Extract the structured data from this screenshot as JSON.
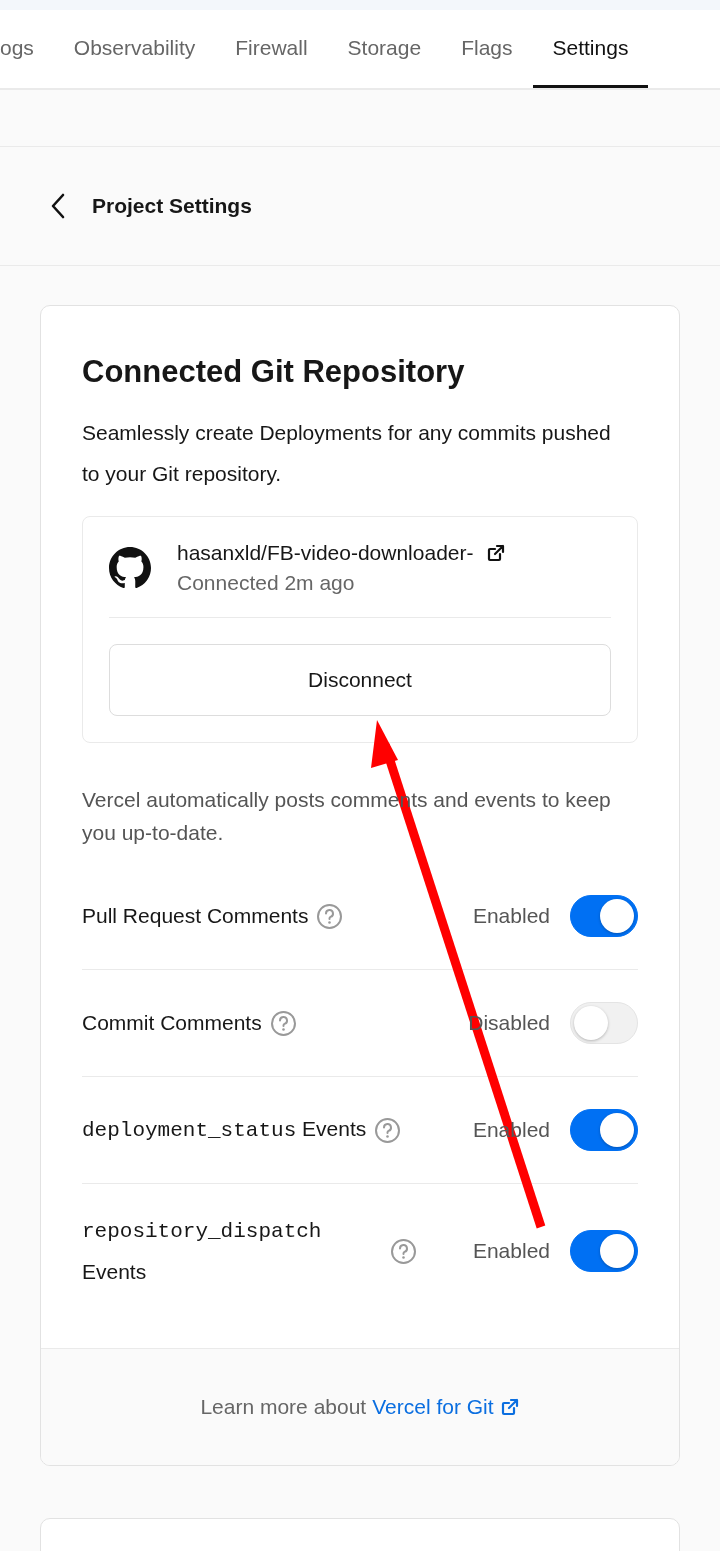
{
  "tabs": [
    {
      "label": "ogs",
      "selected": false
    },
    {
      "label": "Observability",
      "selected": false
    },
    {
      "label": "Firewall",
      "selected": false
    },
    {
      "label": "Storage",
      "selected": false
    },
    {
      "label": "Flags",
      "selected": false
    },
    {
      "label": "Settings",
      "selected": true
    }
  ],
  "header": {
    "title": "Project Settings"
  },
  "card": {
    "title": "Connected Git Repository",
    "description": "Seamlessly create Deployments for any commits pushed to your Git repository.",
    "repo": {
      "name": "hasanxld/FB-video-downloader-",
      "status": "Connected 2m ago",
      "button": "Disconnect"
    },
    "note": "Vercel automatically posts comments and events to keep you up-to-date.",
    "settings": [
      {
        "label": "Pull Request Comments",
        "status": "Enabled",
        "on": true
      },
      {
        "label": "Commit Comments",
        "status": "Disabled",
        "on": false
      },
      {
        "code": "deployment_status",
        "label": "Events",
        "status": "Enabled",
        "on": true
      },
      {
        "code": "repository_dispatch",
        "label": "Events",
        "status": "Enabled",
        "on": true
      }
    ],
    "footer": {
      "text": "Learn more about",
      "link": "Vercel for Git"
    }
  },
  "annotations": [
    {
      "kind": "arrow"
    }
  ]
}
